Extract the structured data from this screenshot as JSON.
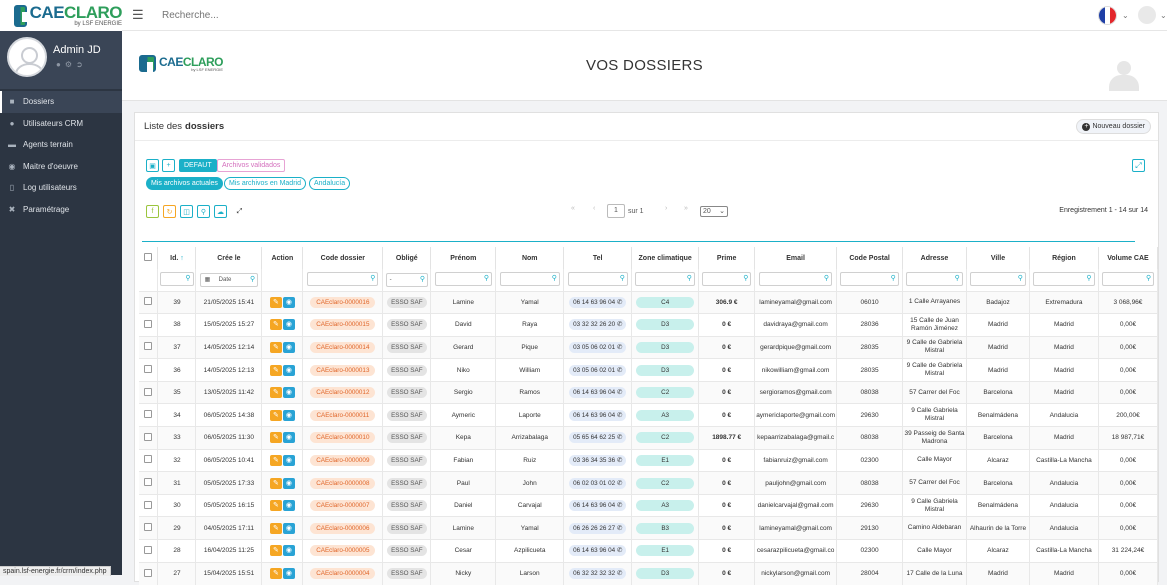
{
  "brand": {
    "name_a": "CAE",
    "name_b": "CLARO",
    "tagline": "by LSF ENERGIE"
  },
  "topbar": {
    "search_placeholder": "Recherche...",
    "flag_colors": [
      "#1f3fa6",
      "#ffffff",
      "#e3262b"
    ]
  },
  "profile": {
    "name": "Admin JD"
  },
  "sidebar": {
    "items": [
      {
        "label": "Dossiers",
        "icon": "users-icon",
        "active": true
      },
      {
        "label": "Utilisateurs CRM",
        "icon": "user-icon"
      },
      {
        "label": "Agents terrain",
        "icon": "truck-icon"
      },
      {
        "label": "Maitre d'oeuvre",
        "icon": "group-icon"
      },
      {
        "label": "Log utilisateurs",
        "icon": "file-icon"
      },
      {
        "label": "Paramétrage",
        "icon": "wrench-icon"
      }
    ]
  },
  "status_url": "spain.lsf-energie.fr/crm/index.php",
  "page": {
    "title": "VOS DOSSIERS"
  },
  "card": {
    "title_pre": "Liste des",
    "title_bold": "dossiers",
    "new_button": "Nouveau dossier"
  },
  "filters": {
    "default": "DEFAUT",
    "archives": "Archivos validados",
    "mis_actuales": "Mis archivos actuales",
    "mis_madrid": "Mis archivos en Madrid",
    "andalucia": "Andalucía"
  },
  "pager": {
    "page": "1",
    "of": "sur 1",
    "page_size": "20",
    "records": "Enregistrement 1 - 14 sur 14"
  },
  "table": {
    "headers": [
      "Id.",
      "Crée le",
      "Action",
      "Code dossier",
      "Obligé",
      "Prénom",
      "Nom",
      "Tel",
      "Zone climatique",
      "Prime",
      "Email",
      "Code Postal",
      "Adresse",
      "Ville",
      "Région",
      "Volume CAE"
    ],
    "date_filter": "Date",
    "dash_filter": "-",
    "rows": [
      {
        "id": "39",
        "date": "21/05/2025 15:41",
        "code": "CAEclaro-0000016",
        "oblige": "ESSO SAF",
        "prenom": "Lamine",
        "nom": "Yamal",
        "tel": "06 14 63 96 04",
        "zone": "C4",
        "prime": "306.9 €",
        "email": "lamineyamal@gmail.com",
        "cp": "06010",
        "adresse": "1 Calle Arrayanes",
        "ville": "Badajoz",
        "region": "Extremadura",
        "volume": "3 068,96€"
      },
      {
        "id": "38",
        "date": "15/05/2025 15:27",
        "code": "CAEclaro-0000015",
        "oblige": "ESSO SAF",
        "prenom": "David",
        "nom": "Raya",
        "tel": "03 32 32 26 20",
        "zone": "D3",
        "prime": "0 €",
        "email": "davidraya@gmail.com",
        "cp": "28036",
        "adresse": "15 Calle de Juan Ramón Jiménez",
        "ville": "Madrid",
        "region": "Madrid",
        "volume": "0,00€"
      },
      {
        "id": "37",
        "date": "14/05/2025 12:14",
        "code": "CAEclaro-0000014",
        "oblige": "ESSO SAF",
        "prenom": "Gerard",
        "nom": "Pique",
        "tel": "03 05 06 02 01",
        "zone": "D3",
        "prime": "0 €",
        "email": "gerardpique@gmail.com",
        "cp": "28035",
        "adresse": "9 Calle de Gabriela Mistral",
        "ville": "Madrid",
        "region": "Madrid",
        "volume": "0,00€"
      },
      {
        "id": "36",
        "date": "14/05/2025 12:13",
        "code": "CAEclaro-0000013",
        "oblige": "ESSO SAF",
        "prenom": "Niko",
        "nom": "William",
        "tel": "03 05 06 02 01",
        "zone": "D3",
        "prime": "0 €",
        "email": "nikowilliam@gmail.com",
        "cp": "28035",
        "adresse": "9 Calle de Gabriela Mistral",
        "ville": "Madrid",
        "region": "Madrid",
        "volume": "0,00€"
      },
      {
        "id": "35",
        "date": "13/05/2025 11:42",
        "code": "CAEclaro-0000012",
        "oblige": "ESSO SAF",
        "prenom": "Sergio",
        "nom": "Ramos",
        "tel": "06 14 63 96 04",
        "zone": "C2",
        "prime": "0 €",
        "email": "sergioramos@gmail.com",
        "cp": "08038",
        "adresse": "57 Carrer del Foc",
        "ville": "Barcelona",
        "region": "Madrid",
        "volume": "0,00€"
      },
      {
        "id": "34",
        "date": "06/05/2025 14:38",
        "code": "CAEclaro-0000011",
        "oblige": "ESSO SAF",
        "prenom": "Aymeric",
        "nom": "Laporte",
        "tel": "06 14 63 96 04",
        "zone": "A3",
        "prime": "0 €",
        "email": "aymericlaporte@gmail.com",
        "cp": "29630",
        "adresse": "9 Calle Gabriela Mistral",
        "ville": "Benalmádena",
        "region": "Andalucia",
        "volume": "200,00€"
      },
      {
        "id": "33",
        "date": "06/05/2025 11:30",
        "code": "CAEclaro-0000010",
        "oblige": "ESSO SAF",
        "prenom": "Kepa",
        "nom": "Arrizabalaga",
        "tel": "05 65 64 62 25",
        "zone": "C2",
        "prime": "1898.77 €",
        "email": "kepaarrizabalaga@gmail.c",
        "cp": "08038",
        "adresse": "39 Passeig de Santa Madrona",
        "ville": "Barcelona",
        "region": "Madrid",
        "volume": "18 987,71€"
      },
      {
        "id": "32",
        "date": "06/05/2025 10:41",
        "code": "CAEclaro-0000009",
        "oblige": "ESSO SAF",
        "prenom": "Fabian",
        "nom": "Ruiz",
        "tel": "03 36 34 35 36",
        "zone": "E1",
        "prime": "0 €",
        "email": "fabianruiz@gmail.com",
        "cp": "02300",
        "adresse": "Calle Mayor",
        "ville": "Alcaraz",
        "region": "Castilla-La Mancha",
        "volume": "0,00€"
      },
      {
        "id": "31",
        "date": "05/05/2025 17:33",
        "code": "CAEclaro-0000008",
        "oblige": "ESSO SAF",
        "prenom": "Paul",
        "nom": "John",
        "tel": "06 02 03 01 02",
        "zone": "C2",
        "prime": "0 €",
        "email": "pauljohn@gmail.com",
        "cp": "08038",
        "adresse": "57 Carrer del Foc",
        "ville": "Barcelona",
        "region": "Andalucia",
        "volume": "0,00€"
      },
      {
        "id": "30",
        "date": "05/05/2025 16:15",
        "code": "CAEclaro-0000007",
        "oblige": "ESSO SAF",
        "prenom": "Daniel",
        "nom": "Carvajal",
        "tel": "06 14 63 96 04",
        "zone": "A3",
        "prime": "0 €",
        "email": "danielcarvajal@gmail.com",
        "cp": "29630",
        "adresse": "9 Calle Gabriela Mistral",
        "ville": "Benalmádena",
        "region": "Andalucia",
        "volume": "0,00€"
      },
      {
        "id": "29",
        "date": "04/05/2025 17:11",
        "code": "CAEclaro-0000006",
        "oblige": "ESSO SAF",
        "prenom": "Lamine",
        "nom": "Yamal",
        "tel": "06 26 26 26 27",
        "zone": "B3",
        "prime": "0 €",
        "email": "lamineyamal@gmail.com",
        "cp": "29130",
        "adresse": "Camino Aldebaran",
        "ville": "Alhaurin de la Torre",
        "region": "Andalucia",
        "volume": "0,00€"
      },
      {
        "id": "28",
        "date": "16/04/2025 11:25",
        "code": "CAEclaro-0000005",
        "oblige": "ESSO SAF",
        "prenom": "Cesar",
        "nom": "Azpilicueta",
        "tel": "06 14 63 96 04",
        "zone": "E1",
        "prime": "0 €",
        "email": "cesarazpilicueta@gmail.co",
        "cp": "02300",
        "adresse": "Calle Mayor",
        "ville": "Alcaraz",
        "region": "Castilla-La Mancha",
        "volume": "31 224,24€"
      },
      {
        "id": "27",
        "date": "15/04/2025 15:51",
        "code": "CAEclaro-0000004",
        "oblige": "ESSO SAF",
        "prenom": "Nicky",
        "nom": "Larson",
        "tel": "06 32 32 32 32",
        "zone": "D3",
        "prime": "0 €",
        "email": "nickylarson@gmail.com",
        "cp": "28004",
        "adresse": "17 Calle de la Luna",
        "ville": "Madrid",
        "region": "Madrid",
        "volume": "0,00€"
      }
    ]
  }
}
